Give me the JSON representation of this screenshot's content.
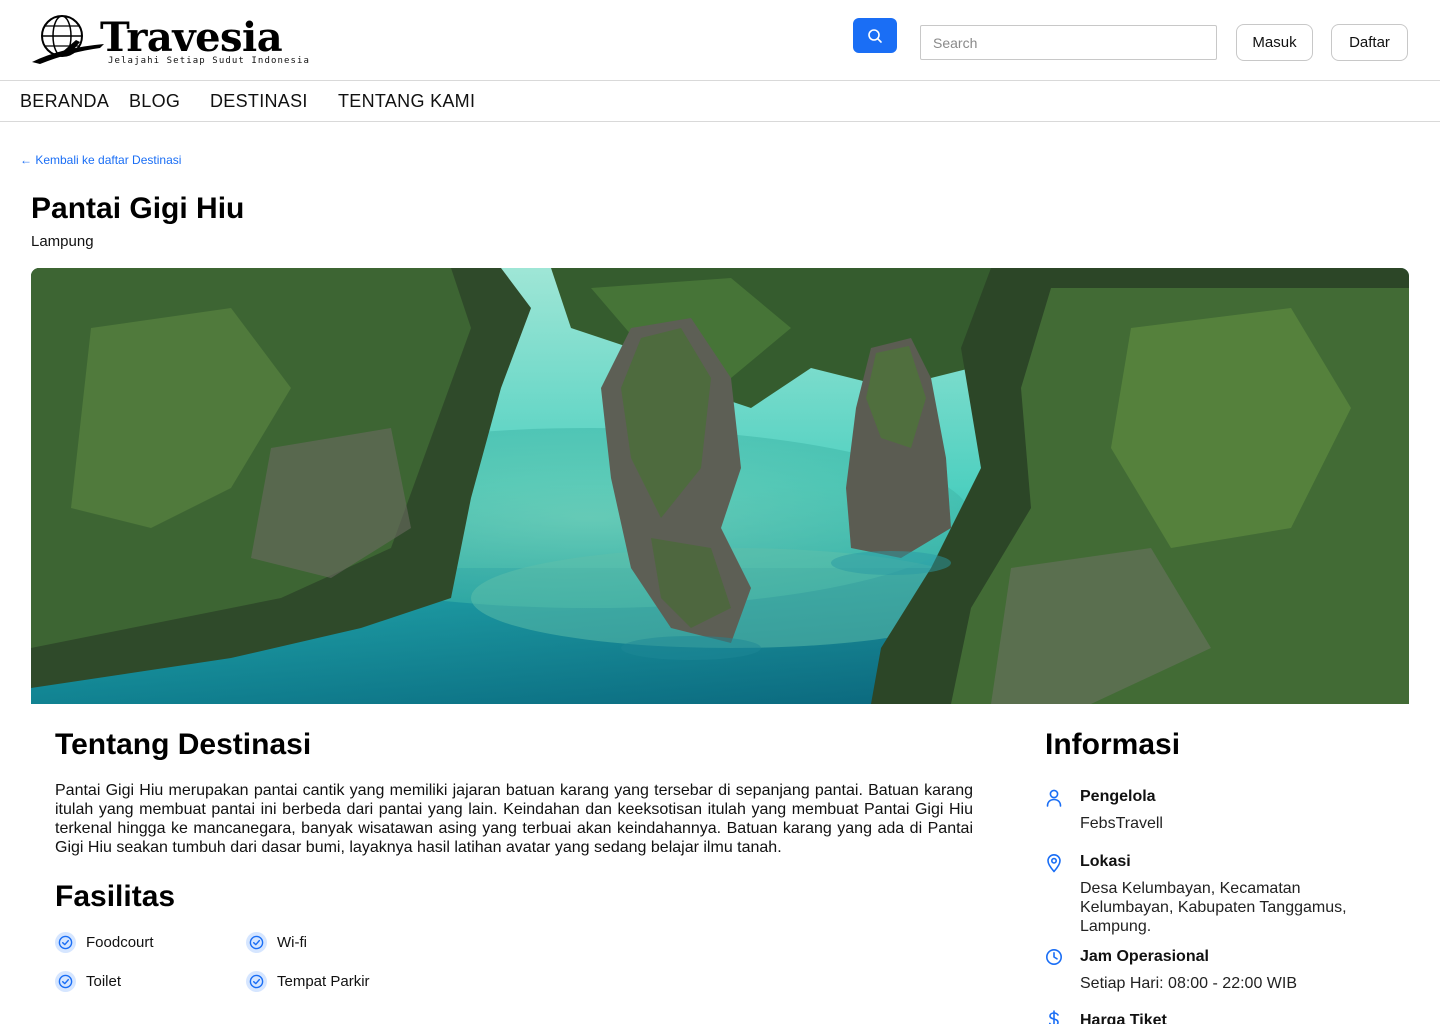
{
  "brand": {
    "name": "Travesia",
    "tagline": "Jelajahi Setiap Sudut Indonesia"
  },
  "header": {
    "search_placeholder": "Search",
    "login_label": "Masuk",
    "register_label": "Daftar"
  },
  "nav": {
    "items": [
      {
        "label": "BERANDA"
      },
      {
        "label": "BLOG"
      },
      {
        "label": "DESTINASI"
      },
      {
        "label": "TENTANG KAMI"
      }
    ]
  },
  "page": {
    "back_link": "← Kembali ke daftar Destinasi",
    "title": "Pantai Gigi Hiu",
    "region": "Lampung"
  },
  "about": {
    "heading": "Tentang Destinasi",
    "text": "Pantai Gigi Hiu merupakan pantai cantik yang memiliki jajaran batuan karang yang tersebar di sepanjang pantai. Batuan karang itulah yang membuat pantai ini berbeda dari pantai yang lain. Keindahan dan keeksotisan itulah yang membuat Pantai Gigi Hiu terkenal hingga ke mancanegara, banyak wisatawan asing yang terbuai akan keindahannya. Batuan karang yang ada di Pantai Gigi Hiu seakan tumbuh dari dasar bumi, layaknya hasil latihan avatar yang sedang belajar ilmu tanah."
  },
  "facilities": {
    "heading": "Fasilitas",
    "items": [
      {
        "label": "Foodcourt"
      },
      {
        "label": "Wi-fi"
      },
      {
        "label": "Toilet"
      },
      {
        "label": "Tempat Parkir"
      }
    ]
  },
  "info": {
    "heading": "Informasi",
    "items": [
      {
        "icon": "user-icon",
        "label": "Pengelola",
        "value": "FebsTravell"
      },
      {
        "icon": "location-pin-icon",
        "label": "Lokasi",
        "value": "Desa Kelumbayan, Kecamatan Kelumbayan, Kabupaten Tanggamus, Lampung."
      },
      {
        "icon": "clock-icon",
        "label": "Jam Operasional",
        "value": "Setiap Hari: 08:00 - 22:00 WIB"
      },
      {
        "icon": "dollar-icon",
        "label": "Harga Tiket",
        "value": ""
      }
    ]
  },
  "colors": {
    "accent": "#1a6ef5",
    "icon_bg": "#d6e6ff",
    "border": "#d9d9d9"
  }
}
